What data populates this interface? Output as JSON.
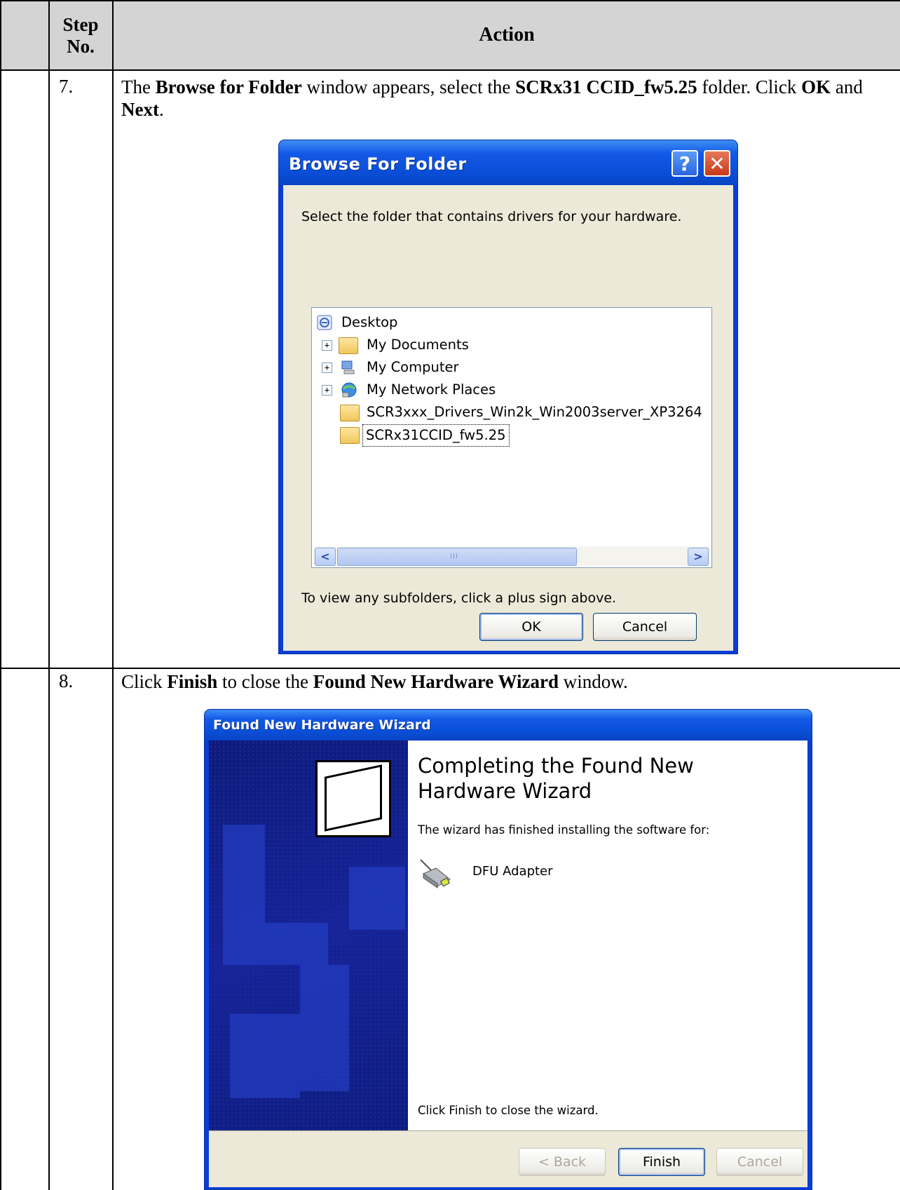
{
  "table": {
    "header": {
      "step_label": "Step No.",
      "action_label": "Action"
    },
    "rows": [
      {
        "step": "7.",
        "instruction": {
          "t1": "The ",
          "b1": "Browse for Folder",
          "t2": " window appears, select the ",
          "b2": "SCRx31 CCID_fw5.25",
          "t3": " folder. Click ",
          "b3": "OK",
          "t4": " and ",
          "b4": "Next",
          "t5": "."
        }
      },
      {
        "step": "8.",
        "instruction": {
          "t1": "Click ",
          "b1": "Finish",
          "t2": " to close the ",
          "b2": "Found New Hardware Wizard",
          "t3": " window."
        }
      }
    ]
  },
  "browse_dialog": {
    "title": "Browse For Folder",
    "help_glyph": "?",
    "close_glyph": "✕",
    "prompt": "Select the folder that contains drivers for your hardware.",
    "tree": [
      {
        "label": "Desktop",
        "icon": "desktop-icon",
        "expandable": false
      },
      {
        "label": "My Documents",
        "icon": "my-documents-icon",
        "expandable": true
      },
      {
        "label": "My Computer",
        "icon": "my-computer-icon",
        "expandable": true
      },
      {
        "label": "My Network Places",
        "icon": "network-places-icon",
        "expandable": true
      },
      {
        "label": "SCR3xxx_Drivers_Win2k_Win2003server_XP3264",
        "icon": "folder-icon",
        "expandable": false
      },
      {
        "label": "SCRx31CCID_fw5.25",
        "icon": "folder-icon",
        "expandable": false,
        "selected": true
      }
    ],
    "expander_glyph": "+",
    "scroll_left": "<",
    "scroll_right": ">",
    "scroll_grip": "III",
    "hint": "To view any subfolders, click a plus sign above.",
    "ok_label": "OK",
    "cancel_label": "Cancel"
  },
  "wizard_dialog": {
    "title": "Found New Hardware Wizard",
    "heading": "Completing the Found New Hardware Wizard",
    "finished_text": "The wizard has finished installing the software for:",
    "device_name": "DFU Adapter",
    "close_text": "Click Finish to close the wizard.",
    "back_label": "< Back",
    "finish_label": "Finish",
    "cancel_label": "Cancel"
  },
  "colors": {
    "xp_title_blue": "#0a4fd8",
    "dialog_face": "#ece9d8",
    "wizard_sidebar": "#16239a",
    "header_shade": "#d4d4d4"
  }
}
